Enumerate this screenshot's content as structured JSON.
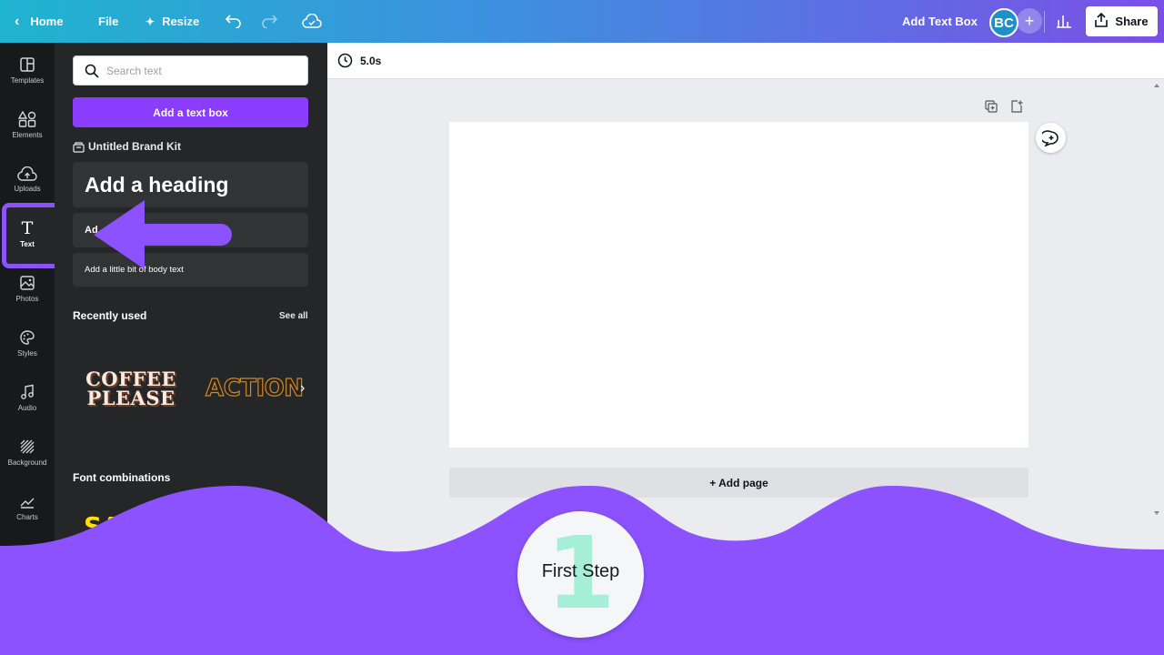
{
  "topbar": {
    "home_label": "Home",
    "file_label": "File",
    "resize_label": "Resize",
    "add_text_box_label": "Add Text Box",
    "avatar_initials": "BC",
    "share_label": "Share"
  },
  "rail": {
    "items": [
      {
        "label": "Templates",
        "icon": "templates-icon"
      },
      {
        "label": "Elements",
        "icon": "elements-icon"
      },
      {
        "label": "Uploads",
        "icon": "uploads-icon"
      },
      {
        "label": "Text",
        "icon": "text-icon"
      },
      {
        "label": "Photos",
        "icon": "photos-icon"
      },
      {
        "label": "Styles",
        "icon": "styles-icon"
      },
      {
        "label": "Audio",
        "icon": "audio-icon"
      },
      {
        "label": "Background",
        "icon": "background-icon"
      },
      {
        "label": "Charts",
        "icon": "charts-icon"
      }
    ],
    "active": "Text"
  },
  "panel": {
    "search_placeholder": "Search text",
    "add_text_box_button": "Add a text box",
    "brand_kit": "Untitled Brand Kit",
    "heading": "Add a heading",
    "subheading_partial": "Ad",
    "body_text": "Add a little bit of body text",
    "recently_used": "Recently used",
    "see_all": "See all",
    "recent_styles": [
      "COFFEE PLEASE",
      "ACTION"
    ],
    "font_combinations": "Font combinations",
    "font_combo_preview": "SA"
  },
  "editor": {
    "duration": "5.0s",
    "add_page": "+ Add page"
  },
  "overlay": {
    "step_number": "1",
    "step_label": "First Step"
  },
  "colors": {
    "brand_purple": "#8b3dff",
    "overlay_purple": "#8c52ff",
    "step_number": "#a6efd7",
    "panel_bg": "#252627",
    "rail_bg": "#18191b"
  }
}
